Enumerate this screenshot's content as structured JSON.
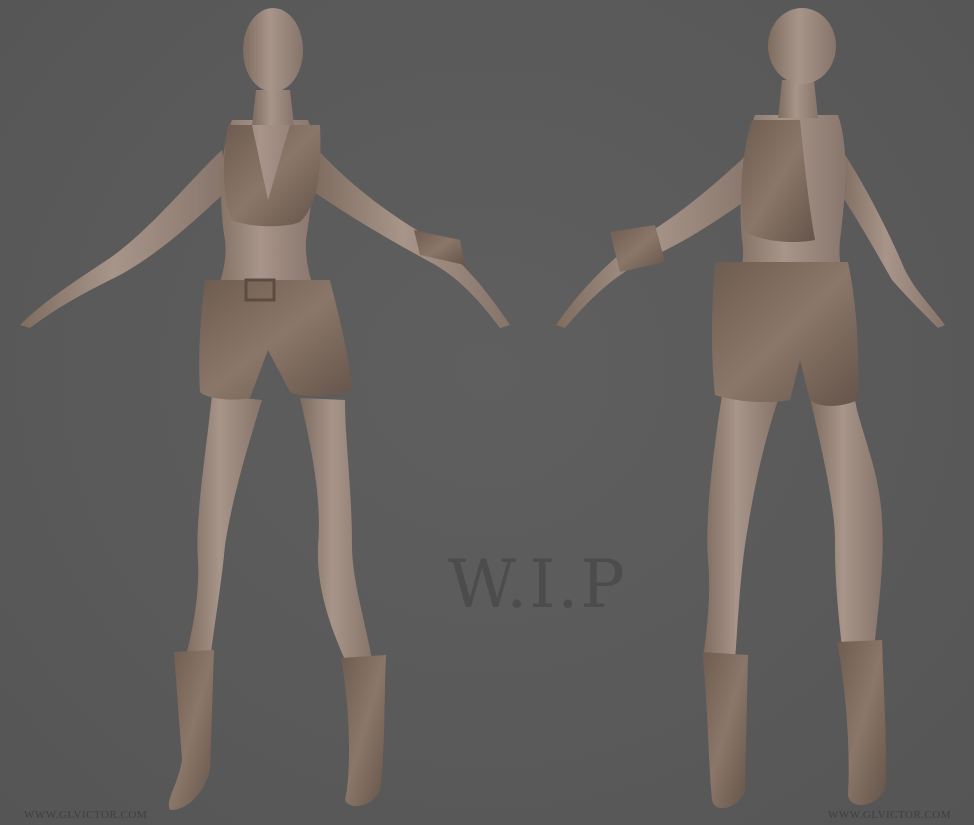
{
  "image": {
    "subject": "3D sculpt turnaround of a female character, front and back views",
    "background_color": "#595959",
    "skin_color": "#9c8878",
    "clothing_color": "#7d6b5d"
  },
  "overlay": {
    "wip_text": "W.I.P",
    "watermark_left": "WWW.GLVICTOR.COM",
    "watermark_right": "WWW.GLVICTOR.COM"
  }
}
